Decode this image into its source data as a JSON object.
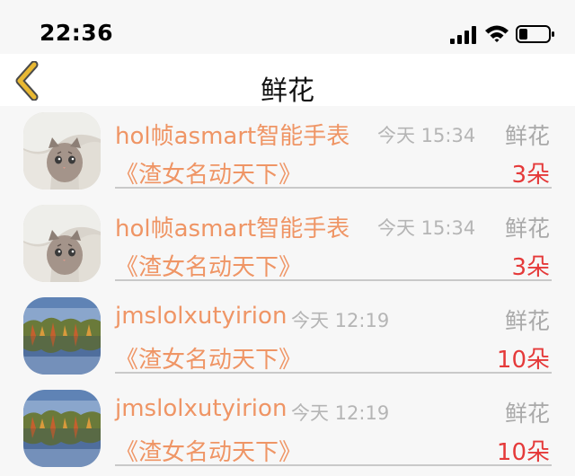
{
  "status_bar": {
    "time": "22:36",
    "icons": [
      "signal-icon",
      "wifi-icon",
      "battery-icon"
    ]
  },
  "nav": {
    "title": "鲜花",
    "back_icon": "chevron-left-icon",
    "accent_color": "#e8b833"
  },
  "colors": {
    "username": "#ef9565",
    "amount": "#e53a3a",
    "muted": "#b5b5b5"
  },
  "rows": [
    {
      "avatar": "kitten-avatar",
      "username": "hol帧asmart智能手表",
      "time": "今天 15:34",
      "gift_type": "鲜花",
      "book_title": "《渣女名动天下》",
      "amount": "3朵"
    },
    {
      "avatar": "kitten-avatar",
      "username": "hol帧asmart智能手表",
      "time": "今天 15:34",
      "gift_type": "鲜花",
      "book_title": "《渣女名动天下》",
      "amount": "3朵"
    },
    {
      "avatar": "lake-avatar",
      "username": "jmslolxutyirion",
      "time": "今天 12:19",
      "gift_type": "鲜花",
      "book_title": "《渣女名动天下》",
      "amount": "10朵"
    },
    {
      "avatar": "lake-avatar",
      "username": "jmslolxutyirion",
      "time": "今天 12:19",
      "gift_type": "鲜花",
      "book_title": "《渣女名动天下》",
      "amount": "10朵"
    }
  ]
}
